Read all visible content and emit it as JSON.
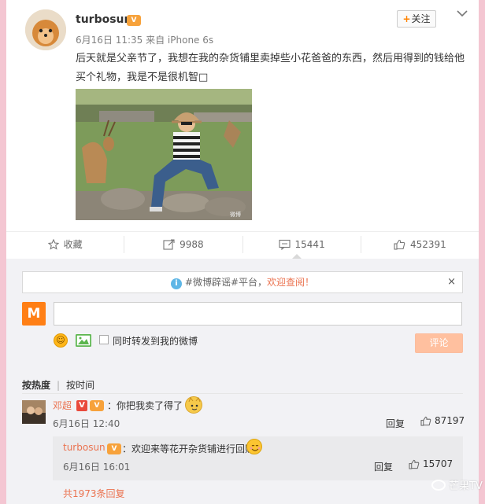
{
  "post": {
    "username": "turbosun",
    "vip_label": "V",
    "meta": "6月16日 11:35 来自 iPhone 6s",
    "follow_label": "关注",
    "text": "后天就是父亲节了，我想在我的杂货铺里卖掉些小花爸爸的东西，然后用得到的钱给他买个礼物，我是不是很机智□"
  },
  "actions": {
    "favorite_label": "收藏",
    "repost_count": "9988",
    "comment_count": "15441",
    "like_count": "452391"
  },
  "comment_box": {
    "notice_prefix": "#微博辟谣#平台，",
    "notice_link": "欢迎查阅！",
    "close_symbol": "×",
    "app_logo_text": "M",
    "input_value": "",
    "repost_option_label": "同时转发到我的微博",
    "submit_label": "评论"
  },
  "sort": {
    "by_hot": "按热度",
    "by_time": "按时间"
  },
  "comments": [
    {
      "name": "邓超",
      "verified_label": "V",
      "text": "：你把我卖了得了",
      "time": "6月16日 12:40",
      "reply_label": "回复",
      "likes": "87197",
      "reply": {
        "name": "turbosun",
        "text": "：欢迎来等花开杂货铺进行回购",
        "time": "6月16日 16:01",
        "reply_label": "回复",
        "likes": "15707"
      }
    }
  ],
  "more_replies": "共1973条回复",
  "watermark": "芒果TV",
  "colors": {
    "accent": "#eb7350",
    "follow_plus": "#ff8200",
    "submit_disabled": "#ffc09f",
    "page_bg": "#f4c6d2"
  }
}
